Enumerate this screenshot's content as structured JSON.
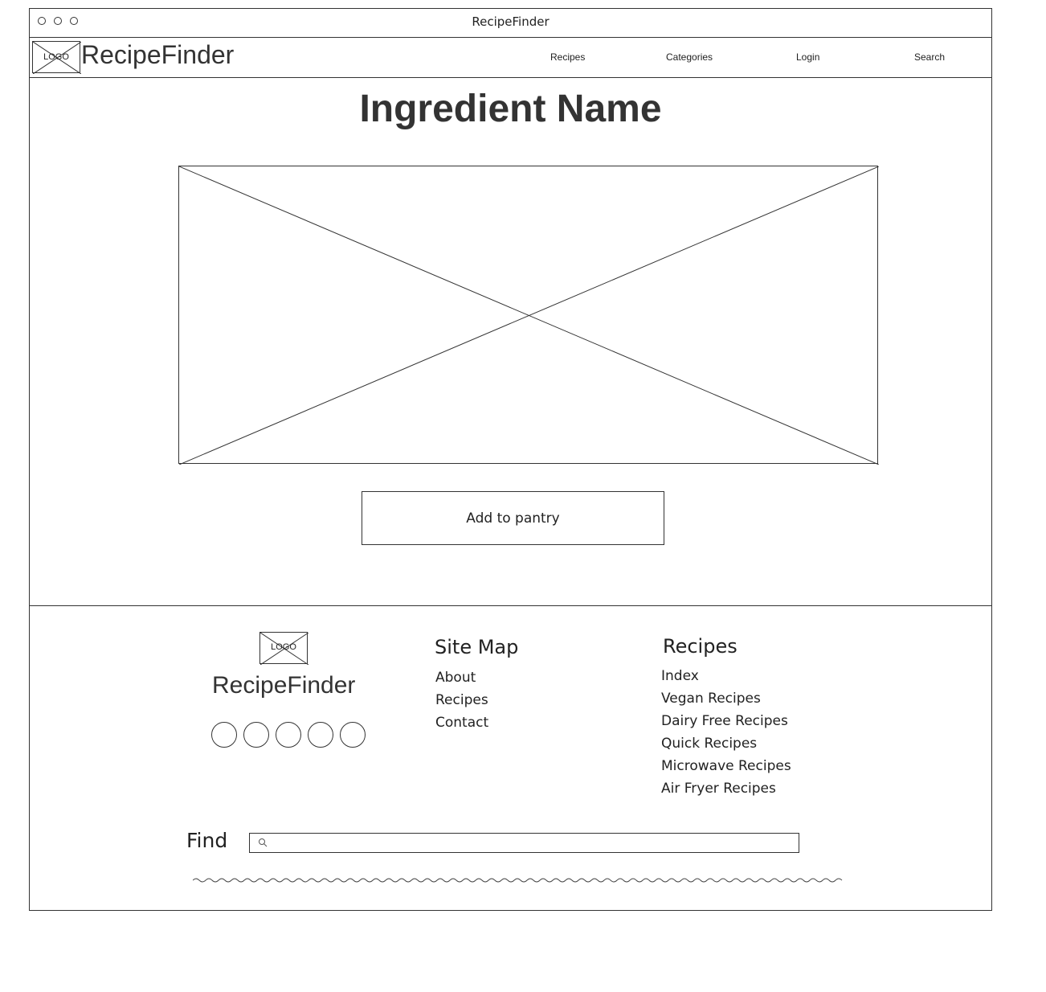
{
  "window": {
    "title": "RecipeFinder"
  },
  "header": {
    "logo_label": "LOGO",
    "brand": "RecipeFinder",
    "nav": [
      {
        "label": "Recipes"
      },
      {
        "label": "Categories"
      },
      {
        "label": "Login"
      },
      {
        "label": "Search"
      }
    ]
  },
  "main": {
    "title": "Ingredient Name",
    "add_button_label": "Add to pantry"
  },
  "footer": {
    "logo_label": "LOGO",
    "brand": "RecipeFinder",
    "social_count": 5,
    "site_map": {
      "heading": "Site Map",
      "links": [
        "About",
        "Recipes",
        "Contact"
      ]
    },
    "recipes": {
      "heading": "Recipes",
      "links": [
        "Index",
        "Vegan Recipes",
        "Dairy Free Recipes",
        "Quick Recipes",
        "Microwave Recipes",
        "Air Fryer Recipes"
      ]
    },
    "find_label": "Find",
    "search": {
      "value": "",
      "placeholder": ""
    }
  }
}
